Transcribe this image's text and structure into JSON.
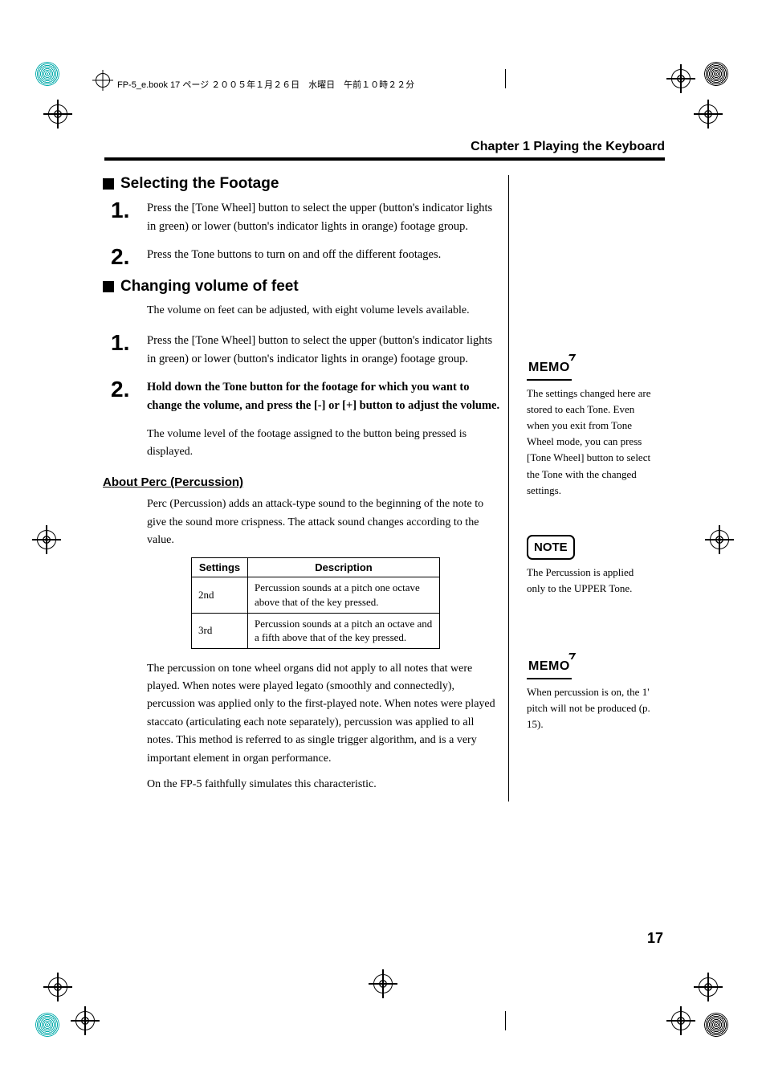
{
  "print_header": "FP-5_e.book  17 ページ  ２００５年１月２６日　水曜日　午前１０時２２分",
  "chapter": "Chapter 1 Playing the Keyboard",
  "section1": {
    "title": "Selecting the Footage",
    "step1": "Press the [Tone Wheel] button to select the upper (button's indicator lights in green) or lower (button's indicator lights in orange) footage group.",
    "step2": "Press the Tone buttons to turn on and off the different footages."
  },
  "section2": {
    "title": "Changing volume of feet",
    "intro": "The volume on feet can be adjusted, with eight volume levels available.",
    "step1": "Press the [Tone Wheel] button to select the upper (button's indicator lights in green) or lower (button's indicator lights in orange) footage group.",
    "step2": "Hold down the Tone button for the footage for which you want to change the volume, and press the [-] or [+] button to adjust the volume.",
    "step2_note": "The volume level of the footage assigned to the button being pressed is displayed."
  },
  "perc": {
    "title": "About Perc (Percussion)",
    "intro": "Perc (Percussion) adds an attack-type sound to the beginning of the note to give the sound more crispness. The attack sound changes according to the value.",
    "table": {
      "head_settings": "Settings",
      "head_desc": "Description",
      "r1_s": "2nd",
      "r1_d": "Percussion sounds at a pitch one octave above that of the key pressed.",
      "r2_s": "3rd",
      "r2_d": "Percussion sounds at a pitch an octave and a fifth above that of the key pressed."
    },
    "para1": "The percussion on tone wheel organs did not apply to all notes that were played. When notes were played legato (smoothly and connectedly), percussion was applied only to the first-played note. When notes were played staccato (articulating each note separately), percussion was applied to all notes. This method is referred to as single trigger algorithm, and is a very important element in organ performance.",
    "para2": "On the FP-5 faithfully simulates this characteristic."
  },
  "side": {
    "memo1_label": "MEMO",
    "memo1_text": "The settings changed here are stored to each Tone. Even when you exit from Tone Wheel mode, you can press [Tone Wheel] button to select the Tone with the changed settings.",
    "note_label": "NOTE",
    "note_text": "The Percussion is applied only to the UPPER Tone.",
    "memo2_label": "MEMO",
    "memo2_text": "When percussion is on, the 1' pitch will not be produced (p. 15)."
  },
  "page_number": "17"
}
